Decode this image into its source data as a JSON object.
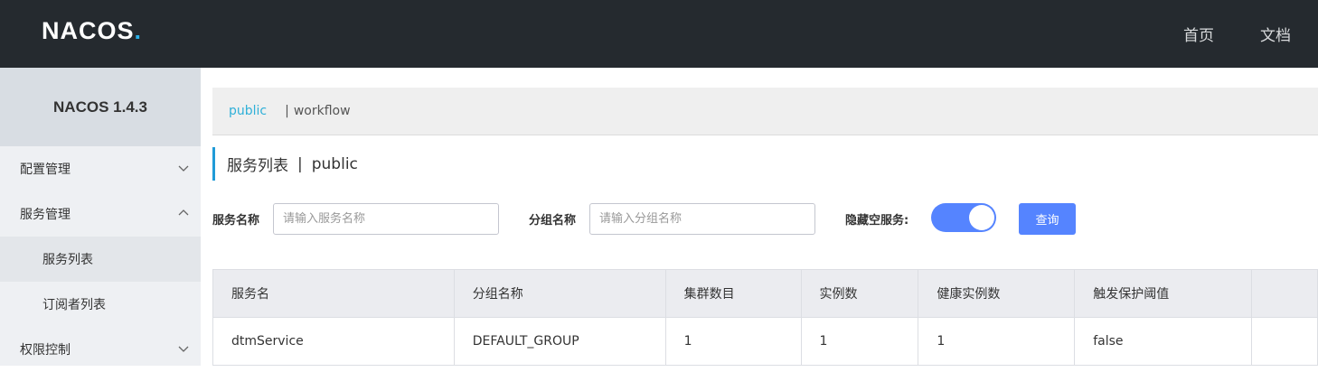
{
  "header": {
    "logo_text": "NACOS",
    "logo_dot": ".",
    "nav": [
      "首页",
      "文档"
    ]
  },
  "sidebar": {
    "title": "NACOS 1.4.3",
    "items": [
      {
        "label": "配置管理",
        "icon": "chevron-down-icon"
      },
      {
        "label": "服务管理",
        "icon": "chevron-up-icon"
      },
      {
        "label": "服务列表"
      },
      {
        "label": "订阅者列表"
      },
      {
        "label": "权限控制",
        "icon": "chevron-down-icon"
      }
    ]
  },
  "namespace": {
    "active": "public",
    "separator": "|",
    "other": "workflow"
  },
  "page": {
    "title": "服务列表",
    "title_sep": "|",
    "title_ns": "public"
  },
  "filters": {
    "service_label": "服务名称",
    "service_placeholder": "请输入服务名称",
    "group_label": "分组名称",
    "group_placeholder": "请输入分组名称",
    "hide_empty_label": "隐藏空服务:",
    "hide_empty_on": true,
    "query_button": "查询"
  },
  "table": {
    "columns": [
      "服务名",
      "分组名称",
      "集群数目",
      "实例数",
      "健康实例数",
      "触发保护阈值",
      ""
    ],
    "rows": [
      [
        "dtmService",
        "DEFAULT_GROUP",
        "1",
        "1",
        "1",
        "false",
        ""
      ]
    ]
  },
  "colors": {
    "accent": "#5584ff",
    "header_bg": "#252a2f",
    "ns_active": "#2fb0d8"
  }
}
